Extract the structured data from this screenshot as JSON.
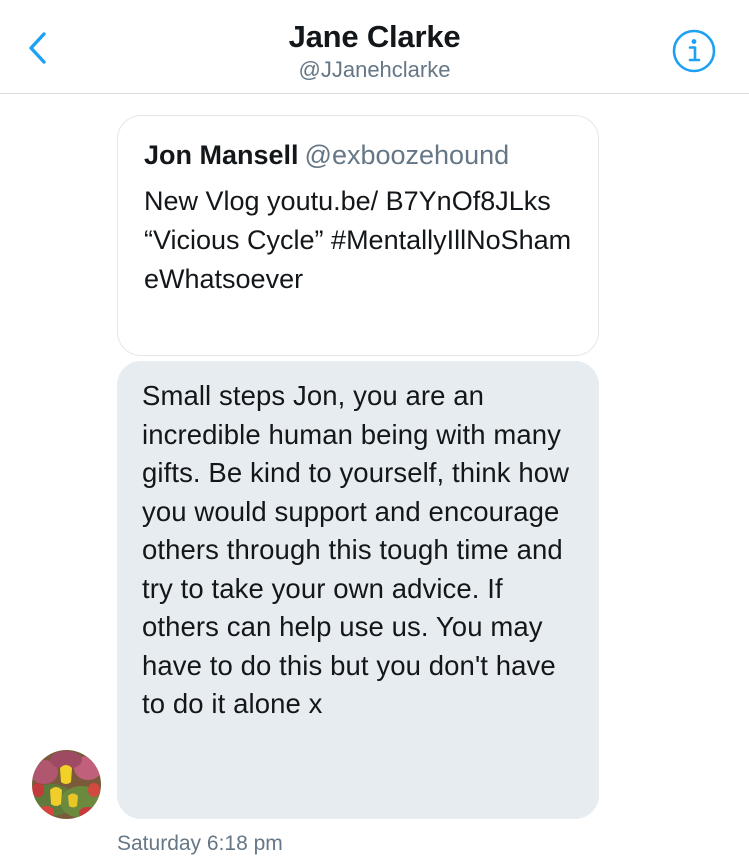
{
  "header": {
    "title": "Jane Clarke",
    "handle": "@JJanehclarke",
    "back_icon": "chevron-left-icon",
    "info_icon": "info-circle-icon"
  },
  "quote": {
    "author_name": "Jon Mansell",
    "author_handle": "@exboozehound",
    "text": "New Vlog youtu.be/ B7YnOf8JLks “Vicious Cycle” #MentallyIllNoShameWhatsoever"
  },
  "message": {
    "text": "Small steps Jon, you are an incredible human being with many gifts.  Be kind to yourself, think how you would support and encourage others through this tough time and try to take your own advice.  If others can help use us. You may have to do this but you don't have to do it alone x",
    "timestamp": "Saturday 6:18 pm"
  },
  "colors": {
    "accent": "#1da1f2",
    "bubble": "#e6ecf0",
    "secondary_text": "#657786",
    "primary_text": "#14171a"
  }
}
